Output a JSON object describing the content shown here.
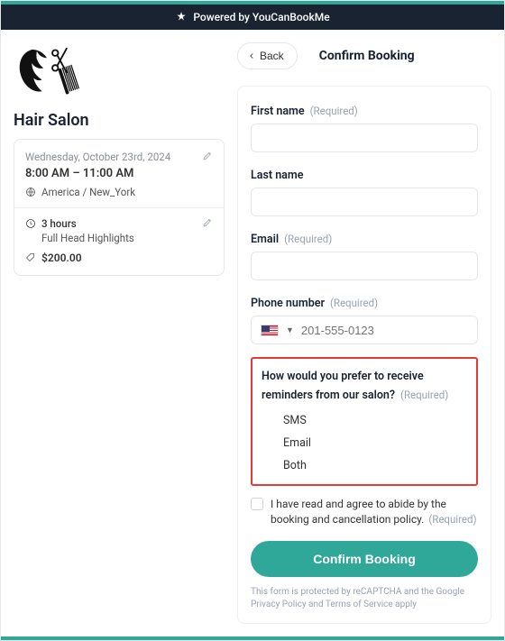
{
  "powered": {
    "text": "Powered by YouCanBookMe"
  },
  "business": {
    "name": "Hair Salon"
  },
  "summary": {
    "date": "Wednesday, October 23rd, 2024",
    "time": "8:00 AM – 11:00 AM",
    "tz": "America / New_York",
    "duration": "3 hours",
    "service": "Full Head Highlights",
    "price": "$200.00"
  },
  "nav": {
    "back": "Back",
    "title": "Confirm Booking"
  },
  "form": {
    "required": "(Required)",
    "first_name": "First name",
    "last_name": "Last name",
    "email": "Email",
    "phone": "Phone number",
    "phone_placeholder": "201-555-0123",
    "reminder_q": "How would you prefer to receive reminders from our salon?",
    "opts": {
      "sms": "SMS",
      "email": "Email",
      "both": "Both"
    },
    "consent": "I have read and agree to abide by the booking and cancellation policy.",
    "submit": "Confirm Booking",
    "footnote": "This form is protected by reCAPTCHA and the Google Privacy Policy and Terms of Service apply"
  }
}
